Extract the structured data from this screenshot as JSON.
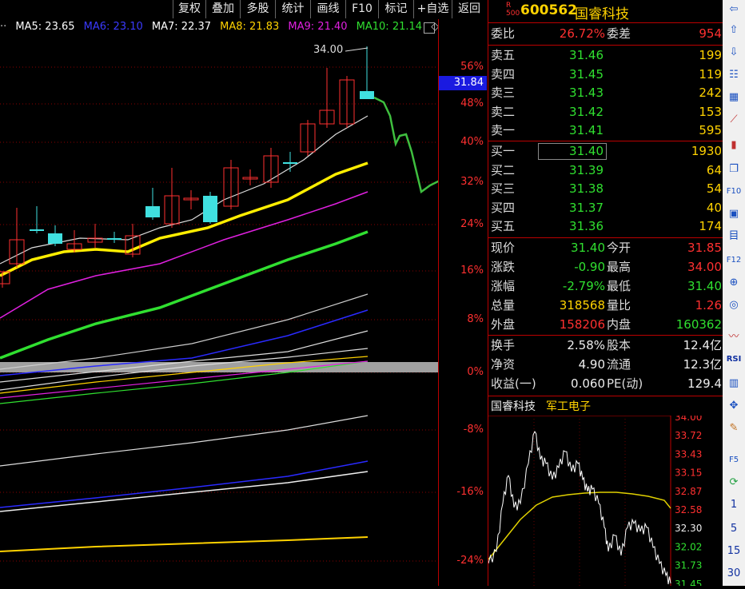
{
  "toolbar_top": [
    "复权",
    "叠加",
    "多股",
    "统计",
    "画线",
    "F10",
    "标记",
    "+自选",
    "返回"
  ],
  "ma": [
    {
      "label": "MA5: 23.65",
      "color": "#ffffff"
    },
    {
      "label": "MA6: 23.10",
      "color": "#3a3aff"
    },
    {
      "label": "MA7: 22.37",
      "color": "#ffffff"
    },
    {
      "label": "MA8: 21.83",
      "color": "#ffd200"
    },
    {
      "label": "MA9: 21.40",
      "color": "#e020e0"
    },
    {
      "label": "MA10: 21.14",
      "color": "#30e030"
    }
  ],
  "ma_marker": "◇",
  "high_label": "34.00",
  "current_price_tag": "31.84",
  "axis_pct": [
    "56%",
    "48%",
    "40%",
    "32%",
    "24%",
    "16%",
    "8%",
    "0%",
    "-8%",
    "-16%",
    "-24%"
  ],
  "stock": {
    "badge_r": "R",
    "badge_num": "500",
    "code": "600562",
    "name": "国睿科技"
  },
  "weibi": {
    "label": "委比",
    "value": "26.72%",
    "label2": "委差",
    "value2": "954"
  },
  "sell": [
    {
      "label": "卖五",
      "price": "31.46",
      "vol": "199"
    },
    {
      "label": "卖四",
      "price": "31.45",
      "vol": "119"
    },
    {
      "label": "卖三",
      "price": "31.43",
      "vol": "242"
    },
    {
      "label": "卖二",
      "price": "31.42",
      "vol": "153"
    },
    {
      "label": "卖一",
      "price": "31.41",
      "vol": "595"
    }
  ],
  "buy": [
    {
      "label": "买一",
      "price": "31.40",
      "vol": "1930"
    },
    {
      "label": "买二",
      "price": "31.39",
      "vol": "64"
    },
    {
      "label": "买三",
      "price": "31.38",
      "vol": "54"
    },
    {
      "label": "买四",
      "price": "31.37",
      "vol": "40"
    },
    {
      "label": "买五",
      "price": "31.36",
      "vol": "174"
    }
  ],
  "quote": [
    {
      "l": "现价",
      "v": "31.40",
      "vc": "green",
      "l2": "今开",
      "v2": "31.85",
      "v2c": "red"
    },
    {
      "l": "涨跌",
      "v": "-0.90",
      "vc": "green",
      "l2": "最高",
      "v2": "34.00",
      "v2c": "red"
    },
    {
      "l": "涨幅",
      "v": "-2.79%",
      "vc": "green",
      "l2": "最低",
      "v2": "31.40",
      "v2c": "green"
    },
    {
      "l": "总量",
      "v": "318568",
      "vc": "yellow",
      "l2": "量比",
      "v2": "1.26",
      "v2c": "red"
    },
    {
      "l": "外盘",
      "v": "158206",
      "vc": "red",
      "l2": "内盘",
      "v2": "160362",
      "v2c": "green"
    }
  ],
  "fund": [
    {
      "l": "换手",
      "v": "2.58%",
      "l2": "股本",
      "v2": "12.4亿"
    },
    {
      "l": "净资",
      "v": "4.90",
      "l2": "流通",
      "v2": "12.3亿"
    },
    {
      "l": "收益(一)",
      "v": "0.060",
      "l2": "PE(动)",
      "v2": "129.4"
    }
  ],
  "mini": {
    "name": "国睿科技",
    "sector": "军工电子",
    "prices": [
      "34.00",
      "33.72",
      "33.43",
      "33.15",
      "32.87",
      "32.58",
      "32.30",
      "32.02",
      "31.73",
      "31.45"
    ]
  },
  "side_nums": [
    "1",
    "5",
    "15",
    "30"
  ],
  "colors": {
    "up": "#ff3030",
    "down": "#30e030",
    "axis": "#b00000"
  }
}
